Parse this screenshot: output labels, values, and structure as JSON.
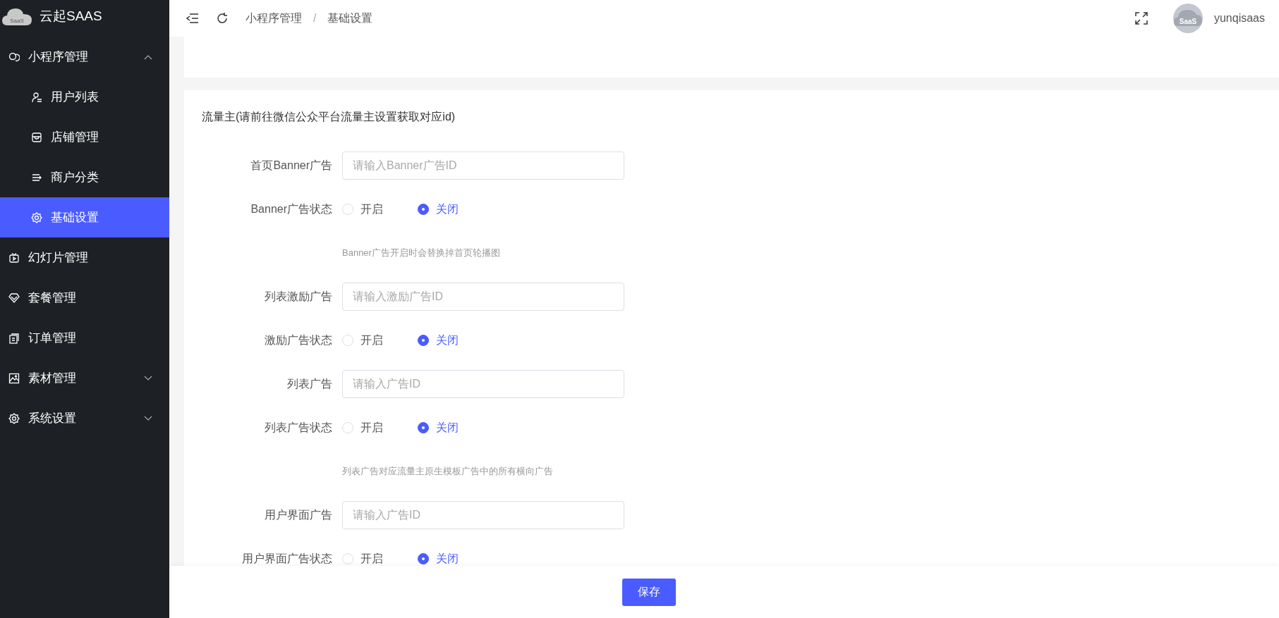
{
  "brand": {
    "logo_text": "SaaS",
    "name": "云起SAAS"
  },
  "sidebar": {
    "items": [
      {
        "label": "小程序管理",
        "expanded": true,
        "selected": false,
        "children": [
          {
            "label": "用户列表",
            "selected": false
          },
          {
            "label": "店铺管理",
            "selected": false
          },
          {
            "label": "商户分类",
            "selected": false
          },
          {
            "label": "基础设置",
            "selected": true
          }
        ]
      },
      {
        "label": "幻灯片管理",
        "selected": false
      },
      {
        "label": "套餐管理",
        "selected": false
      },
      {
        "label": "订单管理",
        "selected": false
      },
      {
        "label": "素材管理",
        "expanded": false,
        "selected": false
      },
      {
        "label": "系统设置",
        "expanded": false,
        "selected": false
      }
    ]
  },
  "header": {
    "breadcrumb": [
      "小程序管理",
      "基础设置"
    ],
    "separator": "/",
    "user": {
      "avatar_text": "SaaS",
      "name": "yunqisaas"
    }
  },
  "form": {
    "title": "流量主(请前往微信公众平台流量主设置获取对应id)",
    "items": [
      {
        "kind": "input",
        "label": "首页Banner广告",
        "placeholder": "请输入Banner广告ID"
      },
      {
        "kind": "radio",
        "label": "Banner广告状态",
        "options": [
          {
            "label": "开启",
            "selected": false
          },
          {
            "label": "关闭",
            "selected": true
          }
        ]
      },
      {
        "kind": "hint",
        "text": "Banner广告开启时会替换掉首页轮播图"
      },
      {
        "kind": "input",
        "label": "列表激励广告",
        "placeholder": "请输入激励广告ID"
      },
      {
        "kind": "radio",
        "label": "激励广告状态",
        "options": [
          {
            "label": "开启",
            "selected": false
          },
          {
            "label": "关闭",
            "selected": true
          }
        ]
      },
      {
        "kind": "input",
        "label": "列表广告",
        "placeholder": "请输入广告ID"
      },
      {
        "kind": "radio",
        "label": "列表广告状态",
        "options": [
          {
            "label": "开启",
            "selected": false
          },
          {
            "label": "关闭",
            "selected": true
          }
        ]
      },
      {
        "kind": "hint",
        "text": "列表广告对应流量主原生模板广告中的所有横向广告"
      },
      {
        "kind": "input",
        "label": "用户界面广告",
        "placeholder": "请输入广告ID"
      },
      {
        "kind": "radio",
        "label": "用户界面广告状态",
        "options": [
          {
            "label": "开启",
            "selected": false
          },
          {
            "label": "关闭",
            "selected": true
          }
        ]
      }
    ]
  },
  "footer": {
    "save_button": "保存"
  }
}
